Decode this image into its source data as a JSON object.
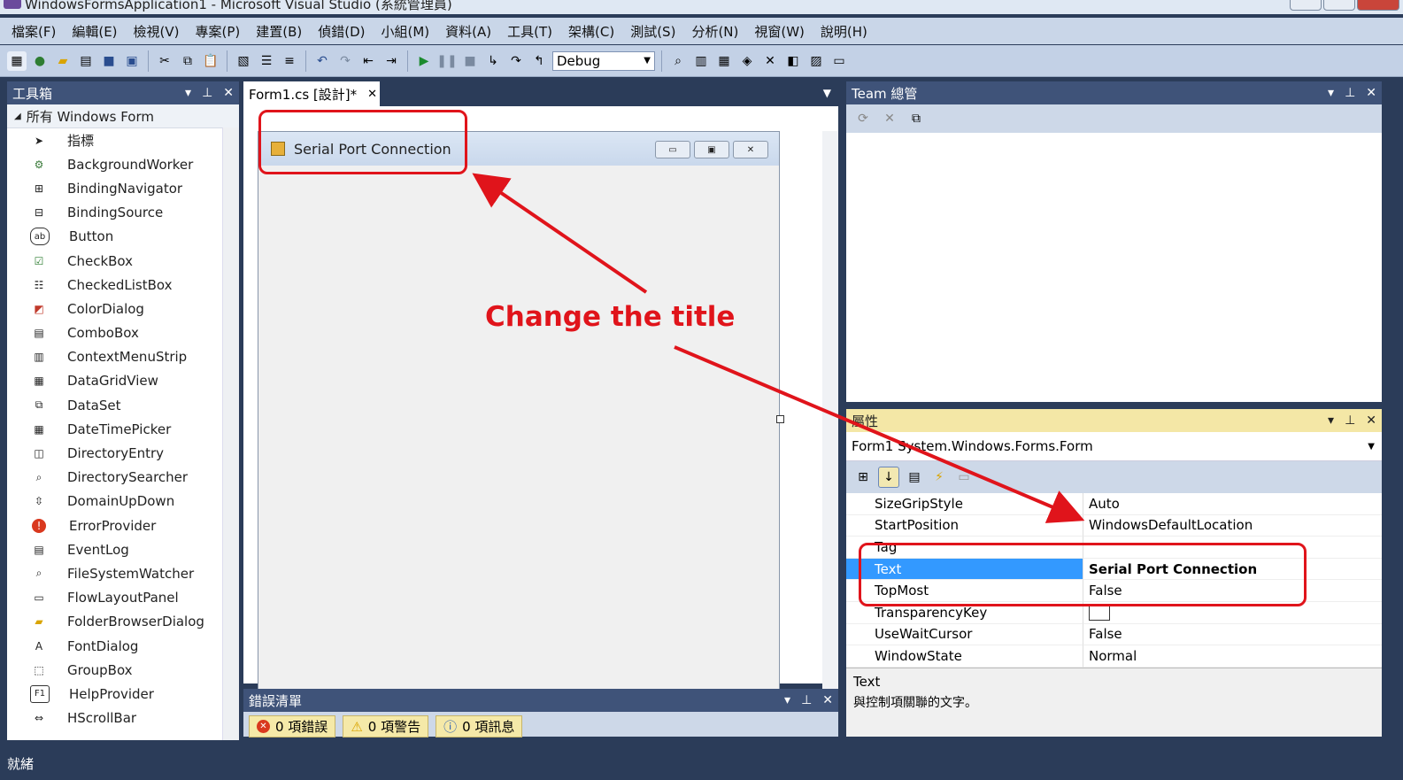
{
  "window": {
    "title": "WindowsFormsApplication1 - Microsoft Visual Studio (系統管理員)"
  },
  "menu": [
    "檔案(F)",
    "編輯(E)",
    "檢視(V)",
    "專案(P)",
    "建置(B)",
    "偵錯(D)",
    "小組(M)",
    "資料(A)",
    "工具(T)",
    "架構(C)",
    "測試(S)",
    "分析(N)",
    "視窗(W)",
    "說明(H)"
  ],
  "toolbar": {
    "config": "Debug"
  },
  "toolbox": {
    "title": "工具箱",
    "category": "所有 Windows Form",
    "items": [
      "指標",
      "BackgroundWorker",
      "BindingNavigator",
      "BindingSource",
      "Button",
      "CheckBox",
      "CheckedListBox",
      "ColorDialog",
      "ComboBox",
      "ContextMenuStrip",
      "DataGridView",
      "DataSet",
      "DateTimePicker",
      "DirectoryEntry",
      "DirectorySearcher",
      "DomainUpDown",
      "ErrorProvider",
      "EventLog",
      "FileSystemWatcher",
      "FlowLayoutPanel",
      "FolderBrowserDialog",
      "FontDialog",
      "GroupBox",
      "HelpProvider",
      "HScrollBar"
    ]
  },
  "designer": {
    "tab": "Form1.cs [設計]*",
    "form_title": "Serial Port Connection"
  },
  "team": {
    "title": "Team 總管"
  },
  "properties": {
    "title": "屬性",
    "object": "Form1",
    "object_type": "System.Windows.Forms.Form",
    "rows": [
      {
        "name": "SizeGripStyle",
        "value": "Auto"
      },
      {
        "name": "StartPosition",
        "value": "WindowsDefaultLocation"
      },
      {
        "name": "Tag",
        "value": ""
      },
      {
        "name": "Text",
        "value": "Serial Port Connection"
      },
      {
        "name": "TopMost",
        "value": "False"
      },
      {
        "name": "TransparencyKey",
        "value": ""
      },
      {
        "name": "UseWaitCursor",
        "value": "False"
      },
      {
        "name": "WindowState",
        "value": "Normal"
      }
    ],
    "desc_title": "Text",
    "desc_body": "與控制項關聯的文字。"
  },
  "errors": {
    "title": "錯誤清單",
    "errors": "0 項錯誤",
    "warnings": "0 項警告",
    "messages": "0 項訊息"
  },
  "status": "就緒",
  "annotation": {
    "text": "Change the title",
    "color": "#e0141b"
  }
}
